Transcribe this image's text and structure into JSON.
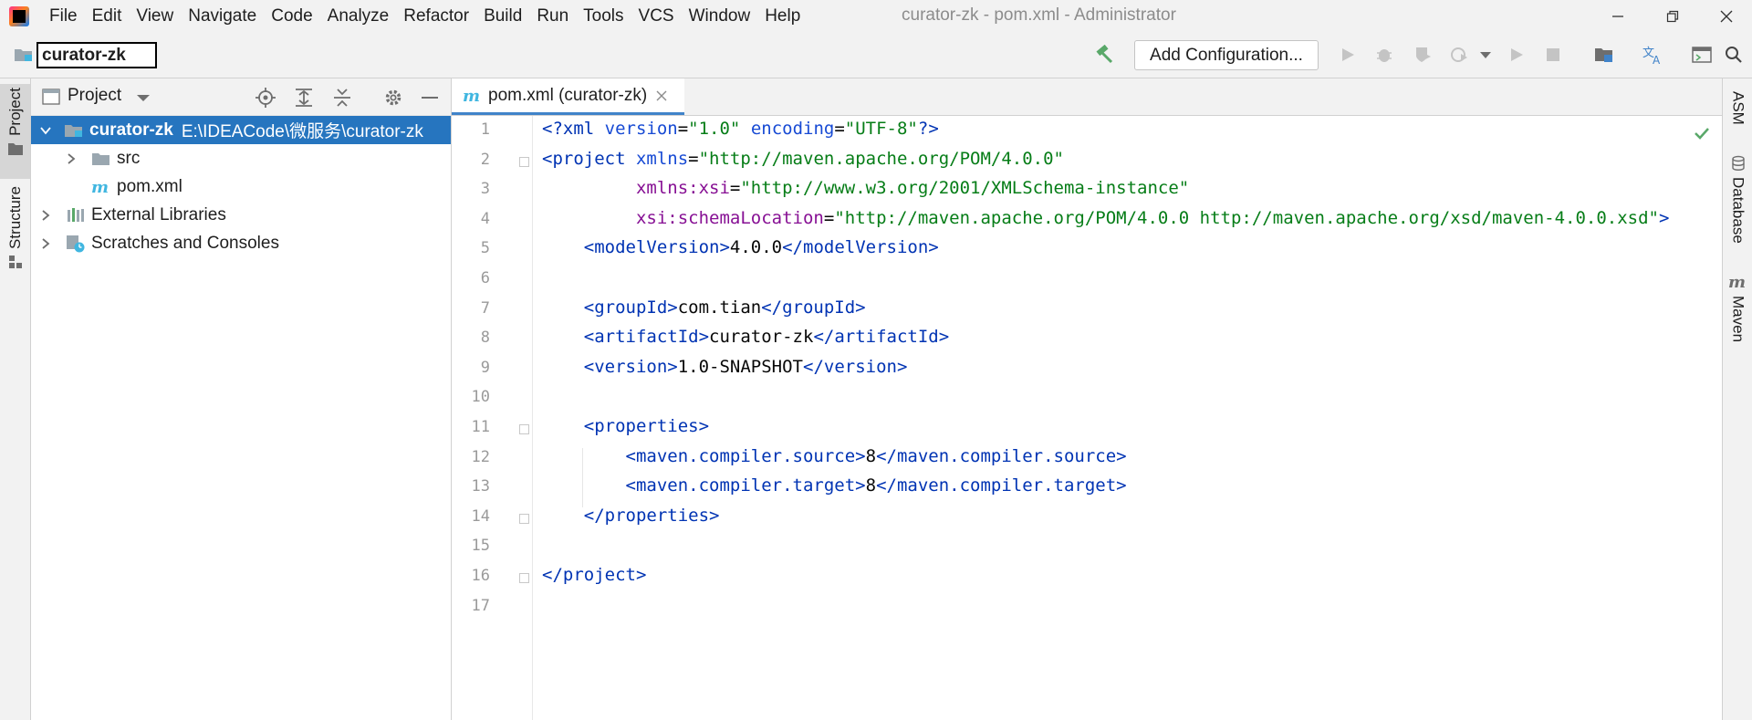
{
  "menubar": {
    "items": [
      "File",
      "Edit",
      "View",
      "Navigate",
      "Code",
      "Analyze",
      "Refactor",
      "Build",
      "Run",
      "Tools",
      "VCS",
      "Window",
      "Help"
    ],
    "window_title": "curator-zk - pom.xml - Administrator"
  },
  "navbar": {
    "project_name": "curator-zk",
    "add_configuration_label": "Add Configuration..."
  },
  "left_strip": {
    "project_tab": "Project",
    "structure_tab": "Structure"
  },
  "project_panel": {
    "view_mode": "Project",
    "tree": [
      {
        "label": "curator-zk",
        "detail": "E:\\IDEACode\\微服务\\curator-zk",
        "depth": 0,
        "expanded": true,
        "selected": true,
        "icon": "module-folder-icon"
      },
      {
        "label": "src",
        "depth": 1,
        "expanded": false,
        "icon": "folder-icon"
      },
      {
        "label": "pom.xml",
        "depth": 1,
        "icon": "maven-file-icon"
      },
      {
        "label": "External Libraries",
        "depth": 0,
        "expanded": false,
        "icon": "libraries-icon"
      },
      {
        "label": "Scratches and Consoles",
        "depth": 0,
        "expanded": false,
        "icon": "scratches-icon"
      }
    ]
  },
  "editor": {
    "tab_label": "pom.xml (curator-zk)",
    "line_numbers": [
      "1",
      "2",
      "3",
      "4",
      "5",
      "6",
      "7",
      "8",
      "9",
      "10",
      "11",
      "12",
      "13",
      "14",
      "15",
      "16",
      "17"
    ],
    "lines": [
      [
        [
          "tag",
          "<?xml "
        ],
        [
          "attr",
          "version"
        ],
        [
          "text",
          "="
        ],
        [
          "val",
          "\"1.0\""
        ],
        [
          "text",
          " "
        ],
        [
          "attr",
          "encoding"
        ],
        [
          "text",
          "="
        ],
        [
          "val",
          "\"UTF-8\""
        ],
        [
          "tag",
          "?>"
        ]
      ],
      [
        [
          "tag",
          "<project "
        ],
        [
          "attr",
          "xmlns"
        ],
        [
          "text",
          "="
        ],
        [
          "val",
          "\"http://maven.apache.org/POM/4.0.0\""
        ]
      ],
      [
        [
          "text",
          "         "
        ],
        [
          "ns",
          "xmlns:xsi"
        ],
        [
          "text",
          "="
        ],
        [
          "val",
          "\"http://www.w3.org/2001/XMLSchema-instance\""
        ]
      ],
      [
        [
          "text",
          "         "
        ],
        [
          "ns",
          "xsi:schemaLocation"
        ],
        [
          "text",
          "="
        ],
        [
          "val",
          "\"http://maven.apache.org/POM/4.0.0 http://maven.apache.org/xsd/maven-4.0.0.xsd\""
        ],
        [
          "tag",
          ">"
        ]
      ],
      [
        [
          "text",
          "    "
        ],
        [
          "tag",
          "<modelVersion>"
        ],
        [
          "text",
          "4.0.0"
        ],
        [
          "tag",
          "</modelVersion>"
        ]
      ],
      [],
      [
        [
          "text",
          "    "
        ],
        [
          "tag",
          "<groupId>"
        ],
        [
          "text",
          "com.tian"
        ],
        [
          "tag",
          "</groupId>"
        ]
      ],
      [
        [
          "text",
          "    "
        ],
        [
          "tag",
          "<artifactId>"
        ],
        [
          "text",
          "curator-zk"
        ],
        [
          "tag",
          "</artifactId>"
        ]
      ],
      [
        [
          "text",
          "    "
        ],
        [
          "tag",
          "<version>"
        ],
        [
          "text",
          "1.0-SNAPSHOT"
        ],
        [
          "tag",
          "</version>"
        ]
      ],
      [],
      [
        [
          "text",
          "    "
        ],
        [
          "tag",
          "<properties>"
        ]
      ],
      [
        [
          "text",
          "        "
        ],
        [
          "tag",
          "<maven.compiler.source>"
        ],
        [
          "text",
          "8"
        ],
        [
          "tag",
          "</maven.compiler.source>"
        ]
      ],
      [
        [
          "text",
          "        "
        ],
        [
          "tag",
          "<maven.compiler.target>"
        ],
        [
          "text",
          "8"
        ],
        [
          "tag",
          "</maven.compiler.target>"
        ]
      ],
      [
        [
          "text",
          "    "
        ],
        [
          "tag",
          "</properties>"
        ]
      ],
      [],
      [
        [
          "tag",
          "</project>"
        ]
      ],
      []
    ]
  },
  "right_strip": {
    "tabs": [
      "ASM",
      "Database",
      "Maven"
    ]
  }
}
